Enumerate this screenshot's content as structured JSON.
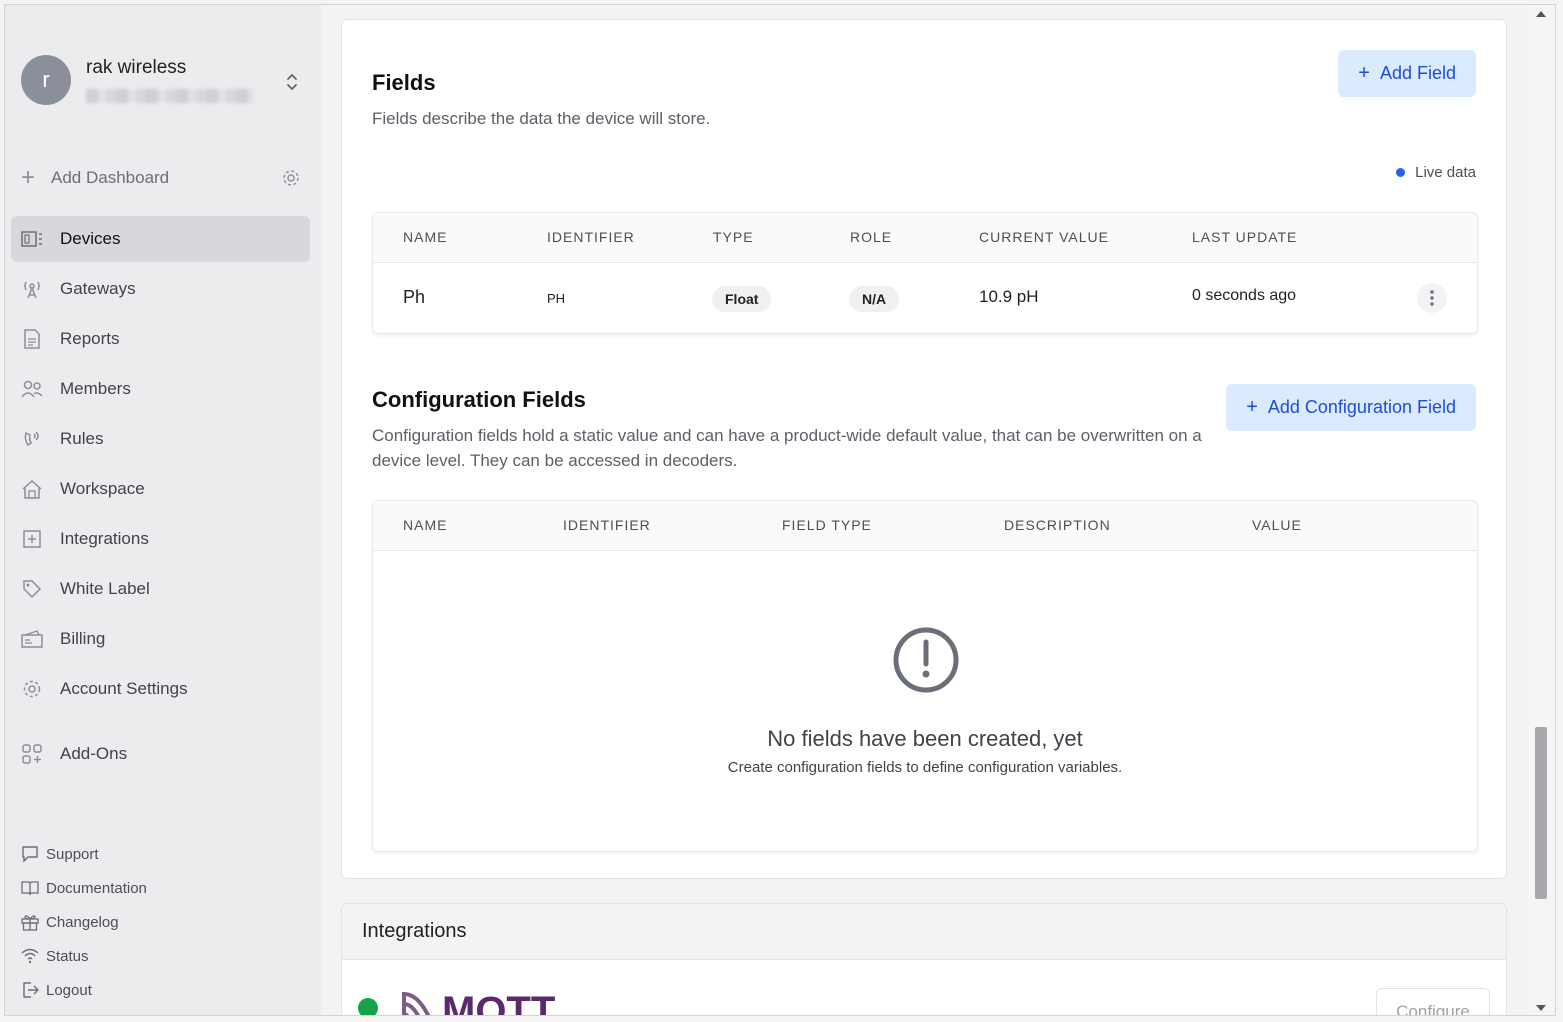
{
  "org": {
    "initial": "r",
    "name": "rak wireless"
  },
  "sidebar": {
    "add_dashboard": "Add Dashboard",
    "items": [
      {
        "label": "Devices",
        "icon": "devices-icon",
        "active": true
      },
      {
        "label": "Gateways",
        "icon": "gateway-icon"
      },
      {
        "label": "Reports",
        "icon": "report-icon"
      },
      {
        "label": "Members",
        "icon": "members-icon"
      },
      {
        "label": "Rules",
        "icon": "rules-icon"
      },
      {
        "label": "Workspace",
        "icon": "workspace-icon"
      },
      {
        "label": "Integrations",
        "icon": "integrations-icon"
      },
      {
        "label": "White Label",
        "icon": "tag-icon"
      },
      {
        "label": "Billing",
        "icon": "billing-icon"
      },
      {
        "label": "Account Settings",
        "icon": "gear-icon"
      }
    ],
    "addons": {
      "label": "Add-Ons",
      "icon": "addons-icon"
    },
    "footer": [
      {
        "label": "Support",
        "icon": "chat-icon"
      },
      {
        "label": "Documentation",
        "icon": "book-icon"
      },
      {
        "label": "Changelog",
        "icon": "gift-icon"
      },
      {
        "label": "Status",
        "icon": "wifi-icon"
      },
      {
        "label": "Logout",
        "icon": "logout-icon"
      }
    ]
  },
  "fields": {
    "title": "Fields",
    "description": "Fields describe the data the device will store.",
    "add_button": "Add Field",
    "live_label": "Live data",
    "columns": [
      "NAME",
      "IDENTIFIER",
      "TYPE",
      "ROLE",
      "CURRENT VALUE",
      "LAST UPDATE"
    ],
    "rows": [
      {
        "name": "Ph",
        "identifier": "PH",
        "type": "Float",
        "role": "N/A",
        "current_value": "10.9 pH",
        "last_update": "0 seconds ago"
      }
    ]
  },
  "config_fields": {
    "title": "Configuration Fields",
    "description": "Configuration fields hold a static value and can have a product-wide default value, that can be overwritten on a device level. They can be accessed in decoders.",
    "add_button": "Add Configuration Field",
    "columns": [
      "NAME",
      "IDENTIFIER",
      "FIELD TYPE",
      "DESCRIPTION",
      "VALUE"
    ],
    "empty_title": "No fields have been created, yet",
    "empty_subtitle": "Create configuration fields to define configuration variables."
  },
  "integrations": {
    "title": "Integrations",
    "configure_label": "Configure",
    "status_color": "#16a34a",
    "logo_text": "MQTT"
  }
}
